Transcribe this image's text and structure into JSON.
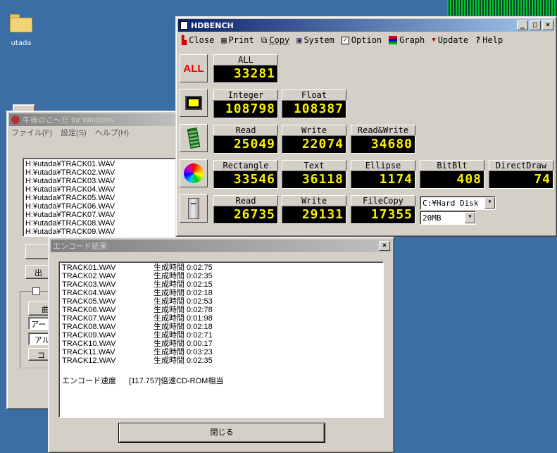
{
  "desktop": {
    "folder_label": "utada"
  },
  "jp_window": {
    "title": "午後のこ〜だ for Windows",
    "menu": [
      "ファイル(F)",
      "設定(S)",
      "ヘルプ(H)"
    ],
    "files": [
      "H:¥utada¥TRACK01.WAV",
      "H:¥utada¥TRACK02.WAV",
      "H:¥utada¥TRACK03.WAV",
      "H:¥utada¥TRACK04.WAV",
      "H:¥utada¥TRACK05.WAV",
      "H:¥utada¥TRACK06.WAV",
      "H:¥utada¥TRACK07.WAV",
      "H:¥utada¥TRACK08.WAV",
      "H:¥utada¥TRACK09.WAV"
    ],
    "partial": {
      "out": "出",
      "checkbox": "",
      "a": "曲",
      "b": "アー",
      "c": "アル",
      "d": "コ"
    }
  },
  "result_window": {
    "title": "エンコード結果",
    "rows": [
      {
        "file": "TRACK01.WAV",
        "time": "生成時間 0:02:75"
      },
      {
        "file": "TRACK02.WAV",
        "time": "生成時間 0:02:35"
      },
      {
        "file": "TRACK03.WAV",
        "time": "生成時間 0:02:15"
      },
      {
        "file": "TRACK04.WAV",
        "time": "生成時間 0:02:18"
      },
      {
        "file": "TRACK05.WAV",
        "time": "生成時間 0:02:53"
      },
      {
        "file": "TRACK06.WAV",
        "time": "生成時間 0:02:78"
      },
      {
        "file": "TRACK07.WAV",
        "time": "生成時間 0:01:98"
      },
      {
        "file": "TRACK08.WAV",
        "time": "生成時間 0:02:18"
      },
      {
        "file": "TRACK09.WAV",
        "time": "生成時間 0:02:71"
      },
      {
        "file": "TRACK10.WAV",
        "time": "生成時間 0:00:17"
      },
      {
        "file": "TRACK11.WAV",
        "time": "生成時間 0:03:23"
      },
      {
        "file": "TRACK12.WAV",
        "time": "生成時間 0:02:35"
      }
    ],
    "speed_label": "エンコード速度",
    "speed_value": "[117.757]倍速CD-ROM相当",
    "close_button": "閉じる"
  },
  "hdbench": {
    "title": "HDBENCH",
    "toolbar": {
      "close": "Close",
      "print": "Print",
      "copy": "Copy",
      "system": "System",
      "option": "Option",
      "graph": "Graph",
      "update": "Update",
      "help": "Help"
    },
    "all": {
      "icon_text": "ALL",
      "label": "ALL",
      "value": "33281"
    },
    "cpu": {
      "integer_label": "Integer",
      "integer_value": "108798",
      "float_label": "Float",
      "float_value": "108387"
    },
    "memory": {
      "read_label": "Read",
      "read_value": "25049",
      "write_label": "Write",
      "write_value": "22074",
      "rw_label": "Read&Write",
      "rw_value": "34680"
    },
    "video": {
      "rect_label": "Rectangle",
      "rect_value": "33546",
      "text_label": "Text",
      "text_value": "36118",
      "ellipse_label": "Ellipse",
      "ellipse_value": "1174",
      "bitblt_label": "BitBlt",
      "bitblt_value": "408",
      "dd_label": "DirectDraw",
      "dd_value": "74"
    },
    "disk": {
      "read_label": "Read",
      "read_value": "26735",
      "write_label": "Write",
      "write_value": "29131",
      "filecopy_label": "FileCopy",
      "filecopy_value": "17355",
      "drive_select": "C:¥Hard Disk",
      "size_select": "20MB"
    }
  },
  "colors": {
    "desktop": "#3a6ea5",
    "led_text": "#f8f000",
    "title_active": "#0a246a"
  }
}
